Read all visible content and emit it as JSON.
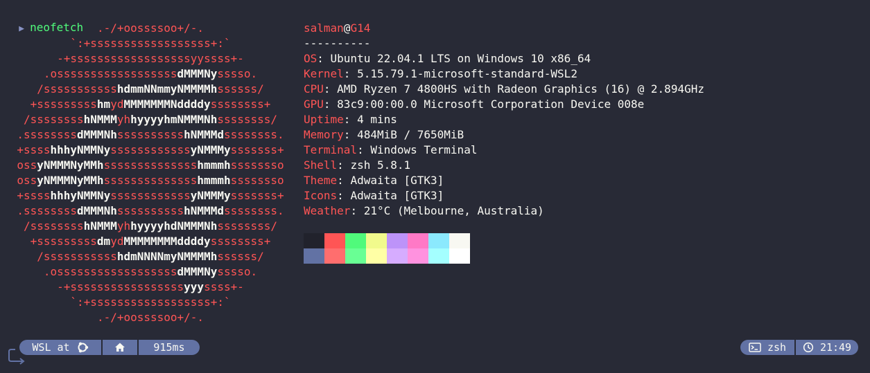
{
  "prompt": {
    "command": "neofetch"
  },
  "logo_lines": [
    [
      {
        "t": ".-/+oossssoo+/-.",
        "c": "r"
      }
    ],
    [
      {
        "t": "`:+ssssssssssssssssss+:`",
        "c": "r"
      }
    ],
    [
      {
        "t": "-+ssssssssssssssssssyyssss+-",
        "c": "r"
      }
    ],
    [
      {
        "t": ".ossssssssssssssssss",
        "c": "r"
      },
      {
        "t": "dMMMNy",
        "c": "w"
      },
      {
        "t": "sssso.",
        "c": "r"
      }
    ],
    [
      {
        "t": "/sssssssssss",
        "c": "r"
      },
      {
        "t": "hdmmNNmmyNMMMMh",
        "c": "w"
      },
      {
        "t": "ssssss/",
        "c": "r"
      }
    ],
    [
      {
        "t": "+sssssssss",
        "c": "r"
      },
      {
        "t": "hm",
        "c": "w"
      },
      {
        "t": "yd",
        "c": "r"
      },
      {
        "t": "MMMMMMMNddddy",
        "c": "w"
      },
      {
        "t": "ssssssss+",
        "c": "r"
      }
    ],
    [
      {
        "t": "/ssssssss",
        "c": "r"
      },
      {
        "t": "hNMMM",
        "c": "w"
      },
      {
        "t": "yh",
        "c": "r"
      },
      {
        "t": "hyyyyhmNMMMNh",
        "c": "w"
      },
      {
        "t": "ssssssss/",
        "c": "r"
      }
    ],
    [
      {
        "t": ".ssssssss",
        "c": "r"
      },
      {
        "t": "dMMMNh",
        "c": "w"
      },
      {
        "t": "ssssssssss",
        "c": "r"
      },
      {
        "t": "hNMMMd",
        "c": "w"
      },
      {
        "t": "ssssssss.",
        "c": "r"
      }
    ],
    [
      {
        "t": "+ssss",
        "c": "r"
      },
      {
        "t": "hhhyNMMNy",
        "c": "w"
      },
      {
        "t": "ssssssssssss",
        "c": "r"
      },
      {
        "t": "yNMMMy",
        "c": "w"
      },
      {
        "t": "sssssss+",
        "c": "r"
      }
    ],
    [
      {
        "t": "oss",
        "c": "r"
      },
      {
        "t": "yNMMMNyMMh",
        "c": "w"
      },
      {
        "t": "ssssssssssssss",
        "c": "r"
      },
      {
        "t": "hmmmh",
        "c": "w"
      },
      {
        "t": "ssssssso",
        "c": "r"
      }
    ],
    [
      {
        "t": "oss",
        "c": "r"
      },
      {
        "t": "yNMMMNyMMh",
        "c": "w"
      },
      {
        "t": "ssssssssssssss",
        "c": "r"
      },
      {
        "t": "hmmmh",
        "c": "w"
      },
      {
        "t": "ssssssso",
        "c": "r"
      }
    ],
    [
      {
        "t": "+ssss",
        "c": "r"
      },
      {
        "t": "hhhyNMMNy",
        "c": "w"
      },
      {
        "t": "ssssssssssss",
        "c": "r"
      },
      {
        "t": "yNMMMy",
        "c": "w"
      },
      {
        "t": "sssssss+",
        "c": "r"
      }
    ],
    [
      {
        "t": ".ssssssss",
        "c": "r"
      },
      {
        "t": "dMMMNh",
        "c": "w"
      },
      {
        "t": "ssssssssss",
        "c": "r"
      },
      {
        "t": "hNMMMd",
        "c": "w"
      },
      {
        "t": "ssssssss.",
        "c": "r"
      }
    ],
    [
      {
        "t": "/ssssssss",
        "c": "r"
      },
      {
        "t": "hNMMM",
        "c": "w"
      },
      {
        "t": "yh",
        "c": "r"
      },
      {
        "t": "hyyyyhdNMMMNh",
        "c": "w"
      },
      {
        "t": "ssssssss/",
        "c": "r"
      }
    ],
    [
      {
        "t": "+sssssssss",
        "c": "r"
      },
      {
        "t": "dm",
        "c": "w"
      },
      {
        "t": "yd",
        "c": "r"
      },
      {
        "t": "MMMMMMMMddddy",
        "c": "w"
      },
      {
        "t": "ssssssss+",
        "c": "r"
      }
    ],
    [
      {
        "t": "/sssssssssss",
        "c": "r"
      },
      {
        "t": "hdmNNNNmyNMMMMh",
        "c": "w"
      },
      {
        "t": "ssssss/",
        "c": "r"
      }
    ],
    [
      {
        "t": ".ossssssssssssssssss",
        "c": "r"
      },
      {
        "t": "dMMMNy",
        "c": "w"
      },
      {
        "t": "sssso.",
        "c": "r"
      }
    ],
    [
      {
        "t": "-+sssssssssssssssss",
        "c": "r"
      },
      {
        "t": "yyy",
        "c": "w"
      },
      {
        "t": "ssss+-",
        "c": "r"
      }
    ],
    [
      {
        "t": "`:+ssssssssssssssssss+:`",
        "c": "r"
      }
    ],
    [
      {
        "t": ".-/+oossssoo+/-.",
        "c": "r"
      }
    ]
  ],
  "info": {
    "user": "salman",
    "at": "@",
    "host": "G14",
    "separator": "----------",
    "fields": [
      {
        "key": "OS",
        "value": "Ubuntu 22.04.1 LTS on Windows 10 x86_64"
      },
      {
        "key": "Kernel",
        "value": "5.15.79.1-microsoft-standard-WSL2"
      },
      {
        "key": "CPU",
        "value": "AMD Ryzen 7 4800HS with Radeon Graphics (16) @ 2.894GHz"
      },
      {
        "key": "GPU",
        "value": "83c9:00:00.0 Microsoft Corporation Device 008e"
      },
      {
        "key": "Uptime",
        "value": "4 mins"
      },
      {
        "key": "Memory",
        "value": "484MiB / 7650MiB"
      },
      {
        "key": "Terminal",
        "value": "Windows Terminal"
      },
      {
        "key": "Shell",
        "value": "zsh 5.8.1"
      },
      {
        "key": "Theme",
        "value": "Adwaita [GTK3]"
      },
      {
        "key": "Icons",
        "value": "Adwaita [GTK3]"
      },
      {
        "key": "Weather",
        "value": "21°C (Melbourne, Australia)"
      }
    ],
    "key_suffix": ": "
  },
  "palette": {
    "row1": [
      "#21222c",
      "#ff5555",
      "#50fa7b",
      "#f1fa8c",
      "#bd93f9",
      "#ff79c6",
      "#8be9fd",
      "#f8f8f2"
    ],
    "row2": [
      "#6272a4",
      "#ff6e6e",
      "#69ff94",
      "#ffffa5",
      "#d6acff",
      "#ff92df",
      "#a4ffff",
      "#ffffff"
    ]
  },
  "statusbar": {
    "wsl_label": "WSL at",
    "os_icon": "ubuntu-icon",
    "home_icon": "home-icon",
    "duration": "915ms",
    "shell_icon": "terminal-icon",
    "shell": "zsh",
    "clock_icon": "clock-icon",
    "time": "21:49"
  },
  "colors": {
    "background": "#282a36",
    "accent": "#ff5555",
    "pill": "#6272a4",
    "command": "#50fa7b"
  }
}
